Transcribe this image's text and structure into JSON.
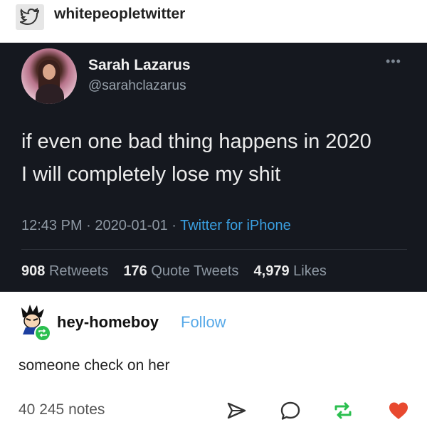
{
  "header": {
    "username": "whitepeopletwitter",
    "avatar_icon": "twitter-bird-icon"
  },
  "tweet": {
    "name": "Sarah Lazarus",
    "handle": "@sarahclazarus",
    "more_icon": "more-dots-icon",
    "text_line1": "if even one bad thing happens in 2020",
    "text_line2": "I will completely lose my shit",
    "time": "12:43 PM",
    "date": "2020-01-01",
    "source": "Twitter for iPhone",
    "retweets_count": "908",
    "retweets_label": "Retweets",
    "quote_count": "176",
    "quote_label": "Quote Tweets",
    "likes_count": "4,979",
    "likes_label": "Likes"
  },
  "reblog": {
    "username": "hey-homeboy",
    "follow_label": "Follow",
    "comment": "someone check on her",
    "badge_icon": "reblog-badge-icon"
  },
  "footer": {
    "notes": "40 245 notes",
    "icons": [
      "share-icon",
      "reply-icon",
      "reblog-icon",
      "heart-icon"
    ],
    "like_color": "#e8492f",
    "reblog_color": "#2bbf4f"
  },
  "colors": {
    "tweet_bg": "#15181f",
    "link": "#3a9fe0",
    "follow": "#57a9e8"
  }
}
